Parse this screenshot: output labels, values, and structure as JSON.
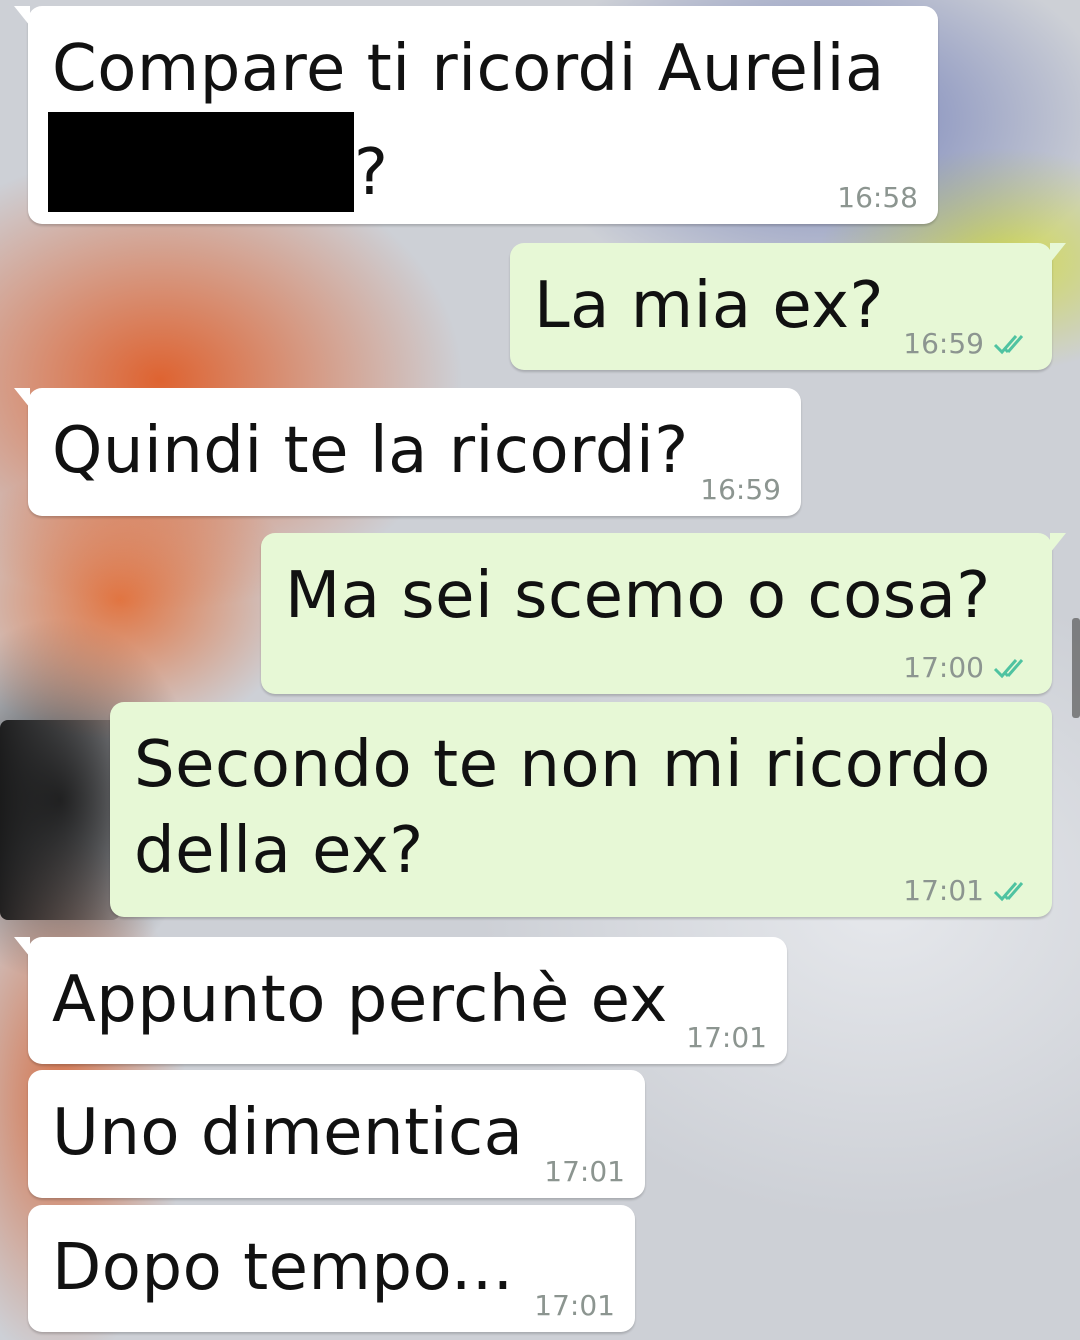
{
  "messages": [
    {
      "direction": "incoming",
      "text_line1": "Compare ti ricordi Aurelia",
      "text_after_redaction": "?",
      "time": "16:58",
      "redacted": true
    },
    {
      "direction": "outgoing",
      "text": "La mia ex?",
      "time": "16:59",
      "status": "read"
    },
    {
      "direction": "incoming",
      "text": "Quindi te la ricordi?",
      "time": "16:59"
    },
    {
      "direction": "outgoing",
      "text": "Ma sei scemo o cosa?",
      "time": "17:00",
      "status": "read"
    },
    {
      "direction": "outgoing",
      "text_line1": "Secondo te non mi ricordo",
      "text_line2": "della ex?",
      "time": "17:01",
      "status": "read"
    },
    {
      "direction": "incoming",
      "text": "Appunto perchè ex",
      "time": "17:01"
    },
    {
      "direction": "incoming",
      "text": "Uno dimentica",
      "time": "17:01"
    },
    {
      "direction": "incoming",
      "text": "Dopo tempo...",
      "time": "17:01"
    }
  ],
  "colors": {
    "incoming_bubble": "#ffffff",
    "outgoing_bubble": "#e7f8d6",
    "read_ticks": "#4fc3a1",
    "timestamp": "#8c9590"
  },
  "icons": {
    "read_receipt": "double-check-icon"
  }
}
